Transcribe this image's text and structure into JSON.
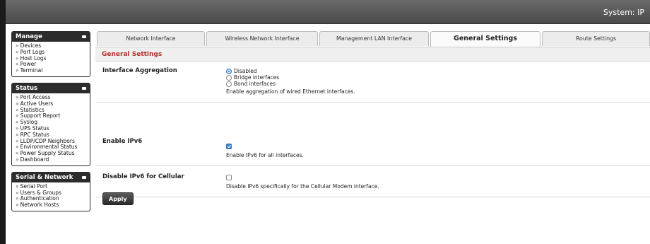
{
  "header": {
    "title": "System: IP"
  },
  "sidebar": {
    "sections": [
      {
        "title": "Manage",
        "items": [
          "Devices",
          "Port Logs",
          "Host Logs",
          "Power",
          "Terminal"
        ]
      },
      {
        "title": "Status",
        "items": [
          "Port Access",
          "Active Users",
          "Statistics",
          "Support Report",
          "Syslog",
          "UPS Status",
          "RPC Status",
          "LLDP/CDP Neighbors",
          "Environmental Status",
          "Power Supply Status",
          "Dashboard"
        ]
      },
      {
        "title": "Serial & Network",
        "items": [
          "Serial Port",
          "Users & Groups",
          "Authentication",
          "Network Hosts"
        ]
      }
    ]
  },
  "tabs": [
    {
      "label": "Network Interface",
      "active": false
    },
    {
      "label": "Wireless Network Interface",
      "active": false
    },
    {
      "label": "Management LAN Interface",
      "active": false
    },
    {
      "label": "General Settings",
      "active": true
    },
    {
      "label": "Route Settings",
      "active": false
    }
  ],
  "section_title": "General Settings",
  "settings": {
    "aggregation": {
      "label": "Interface Aggregation",
      "options": [
        {
          "label": "Disabled",
          "selected": true
        },
        {
          "label": "Bridge interfaces",
          "selected": false
        },
        {
          "label": "Bond interfaces",
          "selected": false
        }
      ],
      "help": "Enable aggregation of wired Ethernet interfaces."
    },
    "ipv6": {
      "label": "Enable IPv6",
      "checked": true,
      "help": "Enable IPv6 for all interfaces."
    },
    "ipv6_cellular": {
      "label": "Disable IPv6 for Cellular",
      "checked": false,
      "help": "Disable IPv6 specifically for the Cellular Modem interface."
    }
  },
  "apply_label": "Apply",
  "colors": {
    "accent": "#b3312b",
    "header_bg": "#555555",
    "sidebar_head": "#2c2c2c",
    "checked_blue": "#3f83d1"
  }
}
